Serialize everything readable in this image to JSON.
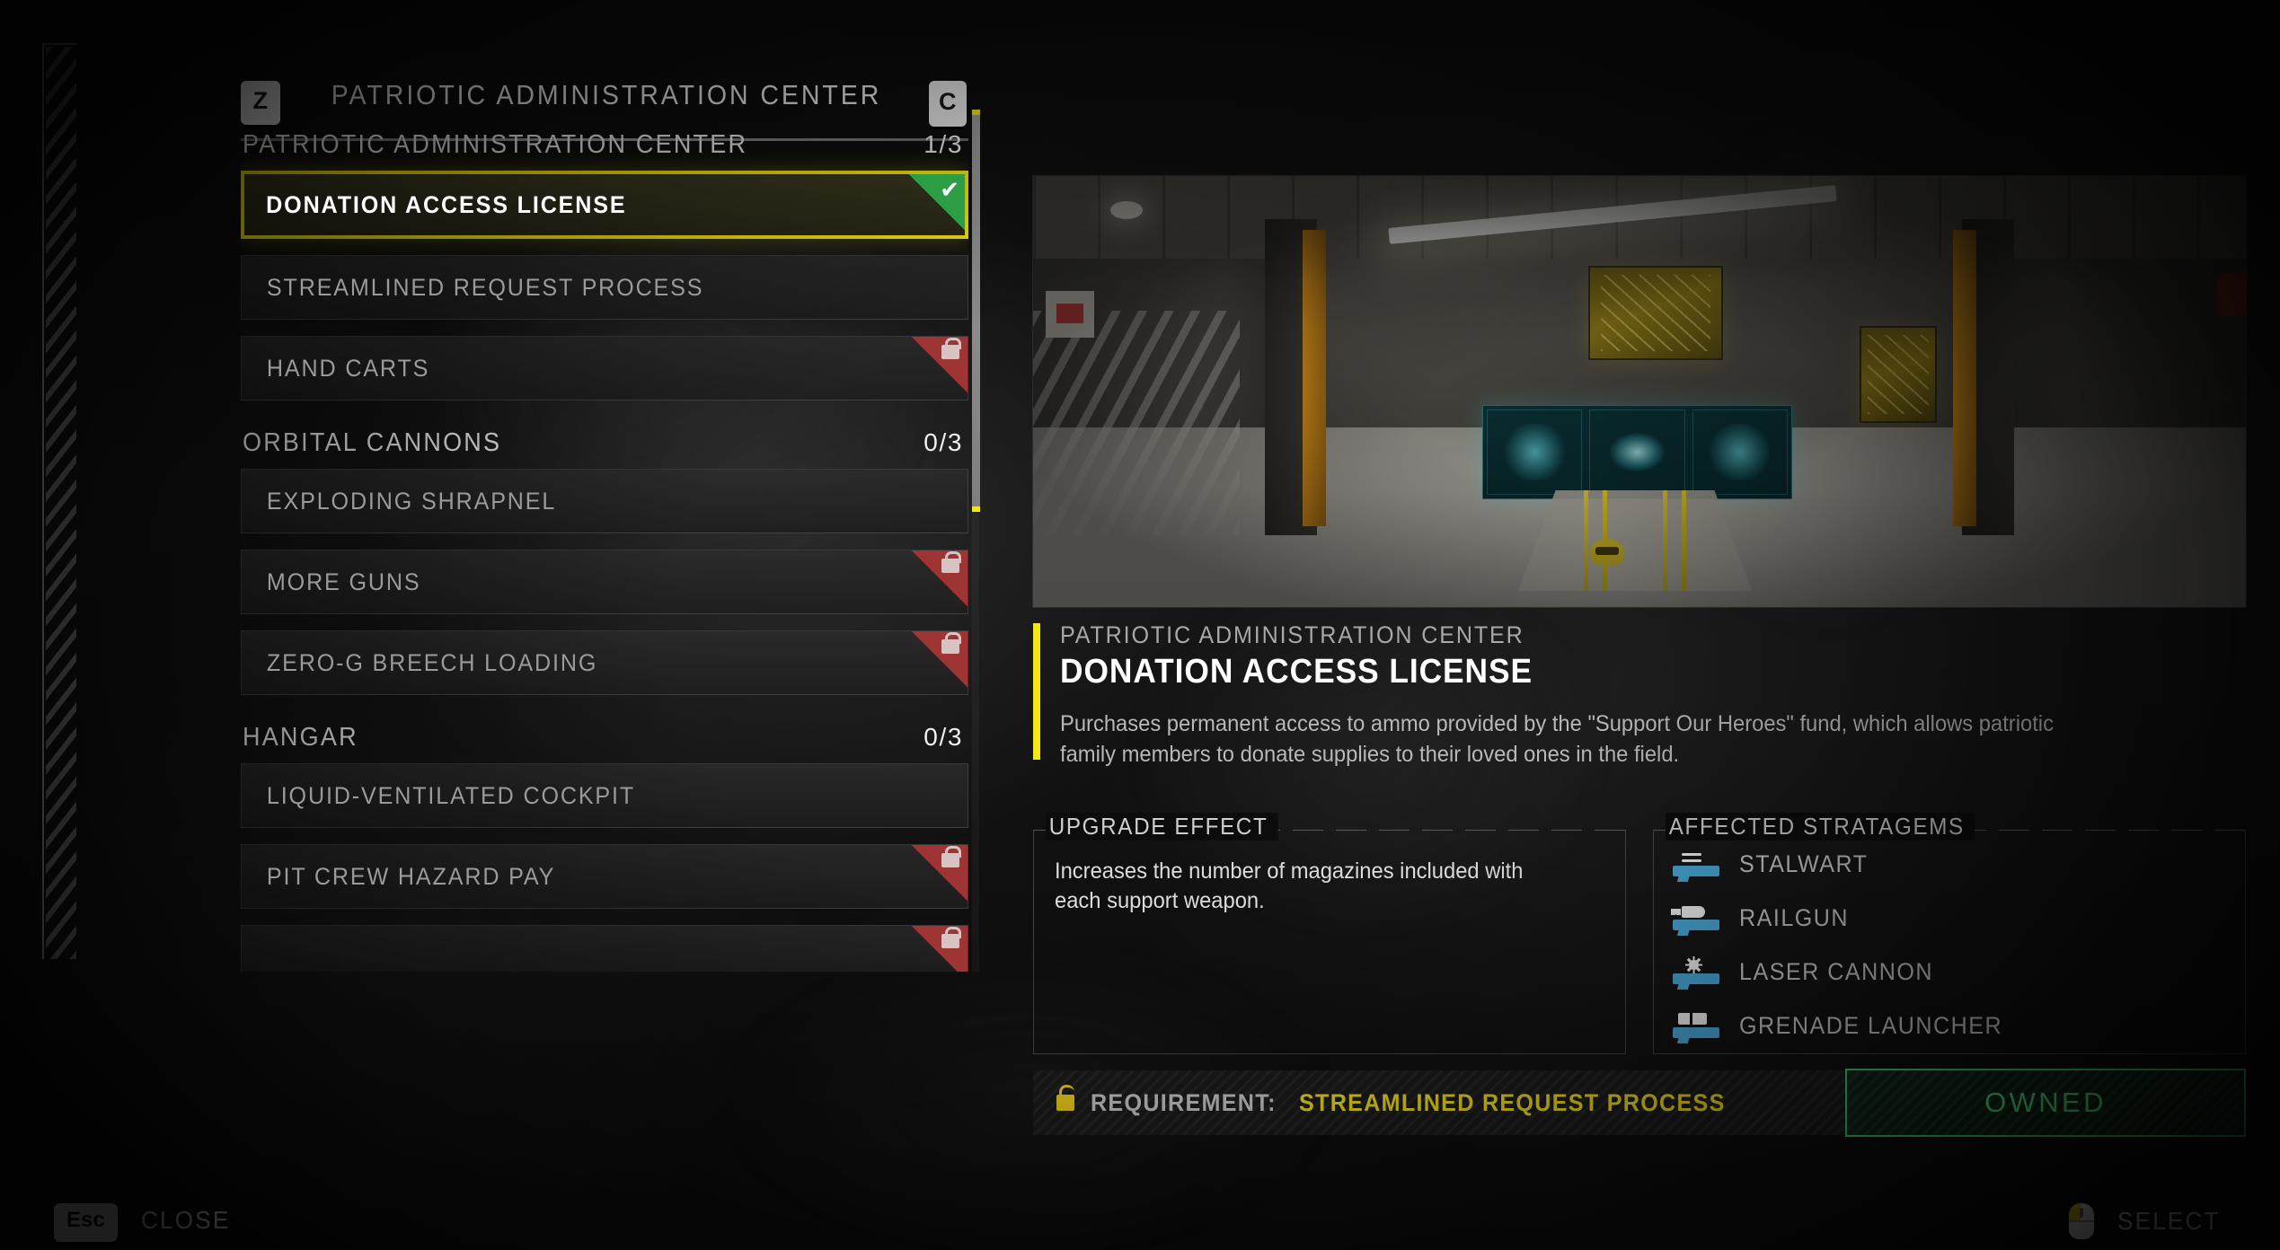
{
  "header": {
    "prev_key": "Z",
    "next_key": "C",
    "title": "PATRIOTIC ADMINISTRATION CENTER"
  },
  "categories": [
    {
      "name": "PATRIOTIC ADMINISTRATION CENTER",
      "count": "1/3",
      "items": [
        {
          "label": "DONATION ACCESS LICENSE",
          "state": "owned",
          "selected": true
        },
        {
          "label": "STREAMLINED REQUEST PROCESS",
          "state": "available",
          "selected": false
        },
        {
          "label": "HAND CARTS",
          "state": "locked",
          "selected": false
        }
      ]
    },
    {
      "name": "ORBITAL CANNONS",
      "count": "0/3",
      "items": [
        {
          "label": "EXPLODING SHRAPNEL",
          "state": "available",
          "selected": false
        },
        {
          "label": "MORE GUNS",
          "state": "locked",
          "selected": false
        },
        {
          "label": "ZERO-G BREECH LOADING",
          "state": "locked",
          "selected": false
        }
      ]
    },
    {
      "name": "HANGAR",
      "count": "0/3",
      "items": [
        {
          "label": "LIQUID-VENTILATED COCKPIT",
          "state": "available",
          "selected": false
        },
        {
          "label": "PIT CREW HAZARD PAY",
          "state": "locked",
          "selected": false
        },
        {
          "label": "",
          "state": "locked",
          "selected": false
        }
      ]
    }
  ],
  "detail": {
    "category": "PATRIOTIC ADMINISTRATION CENTER",
    "name": "DONATION ACCESS LICENSE",
    "description": "Purchases permanent access to ammo provided by the \"Support Our Heroes\" fund, which allows patriotic family members to donate supplies to their loved ones in the field."
  },
  "upgrade_effect": {
    "title": "UPGRADE EFFECT",
    "text": "Increases the number of magazines included with each support weapon."
  },
  "affected_stratagems": {
    "title": "AFFECTED STRATAGEMS",
    "items": [
      {
        "label": "STALWART",
        "icon": "machine-gun-icon"
      },
      {
        "label": "RAILGUN",
        "icon": "railgun-icon"
      },
      {
        "label": "LASER CANNON",
        "icon": "laser-cannon-icon"
      },
      {
        "label": "GRENADE LAUNCHER",
        "icon": "grenade-launcher-icon"
      }
    ]
  },
  "requirement": {
    "label": "REQUIREMENT:",
    "value": "STREAMLINED REQUEST PROCESS"
  },
  "purchase_button": {
    "label": "OWNED"
  },
  "footer": {
    "close_key": "Esc",
    "close_label": "CLOSE",
    "select_label": "SELECT"
  },
  "colors": {
    "accent_yellow": "#f5e416",
    "owned_green": "#3ddc7a",
    "locked_red": "#9e3434",
    "stratagem_blue": "#4aa8d8"
  }
}
